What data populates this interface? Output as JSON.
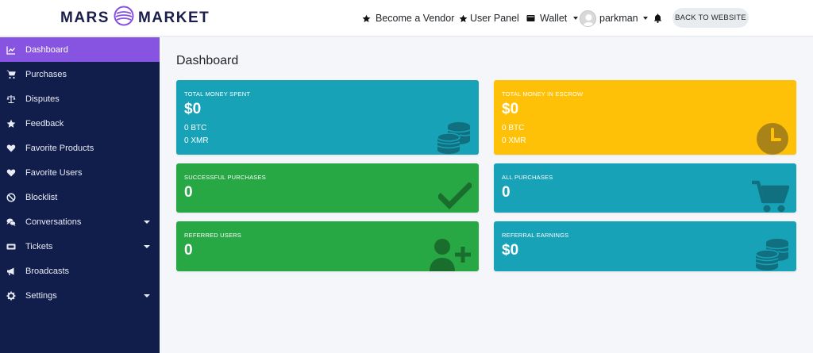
{
  "header": {
    "logo_left": "MARS",
    "logo_right": "MARKET",
    "become_vendor": "Become a Vendor",
    "user_panel": "User Panel",
    "wallet": "Wallet",
    "username": "parkman",
    "back_button": "BACK TO WEBSITE"
  },
  "sidebar": {
    "items": [
      {
        "label": "Dashboard",
        "icon": "chart-line-icon",
        "active": true
      },
      {
        "label": "Purchases",
        "icon": "shopping-cart-icon"
      },
      {
        "label": "Disputes",
        "icon": "balance-scale-icon"
      },
      {
        "label": "Feedback",
        "icon": "star-icon"
      },
      {
        "label": "Favorite Products",
        "icon": "heart-icon"
      },
      {
        "label": "Favorite Users",
        "icon": "heart-icon"
      },
      {
        "label": "Blocklist",
        "icon": "ban-icon"
      },
      {
        "label": "Conversations",
        "icon": "comments-icon",
        "expandable": true
      },
      {
        "label": "Tickets",
        "icon": "ticket-icon",
        "expandable": true
      },
      {
        "label": "Broadcasts",
        "icon": "bullhorn-icon"
      },
      {
        "label": "Settings",
        "icon": "cog-icon",
        "expandable": true
      }
    ]
  },
  "main": {
    "title": "Dashboard",
    "cards": [
      {
        "label": "TOTAL MONEY SPENT",
        "value": "$0",
        "sub1": "0 BTC",
        "sub2": "0 XMR",
        "color": "#17a2b8",
        "icon": "coins-icon"
      },
      {
        "label": "TOTAL MONEY IN ESCROW",
        "value": "$0",
        "sub1": "0 BTC",
        "sub2": "0 XMR",
        "color": "#ffc107",
        "icon": "clock-icon"
      },
      {
        "label": "SUCCESSFUL PURCHASES",
        "value": "0",
        "color": "#28a745",
        "icon": "check-icon"
      },
      {
        "label": "ALL PURCHASES",
        "value": "0",
        "color": "#17a2b8",
        "icon": "shopping-cart-icon"
      },
      {
        "label": "REFERRED USERS",
        "value": "0",
        "color": "#28a745",
        "icon": "user-plus-icon"
      },
      {
        "label": "REFERRAL EARNINGS",
        "value": "$0",
        "color": "#17a2b8",
        "icon": "coins-icon"
      }
    ]
  },
  "colors": {
    "accent": "#8754e1",
    "sidebar_bg": "#111d4a",
    "teal": "#17a2b8",
    "yellow": "#ffc107",
    "green": "#28a745"
  }
}
